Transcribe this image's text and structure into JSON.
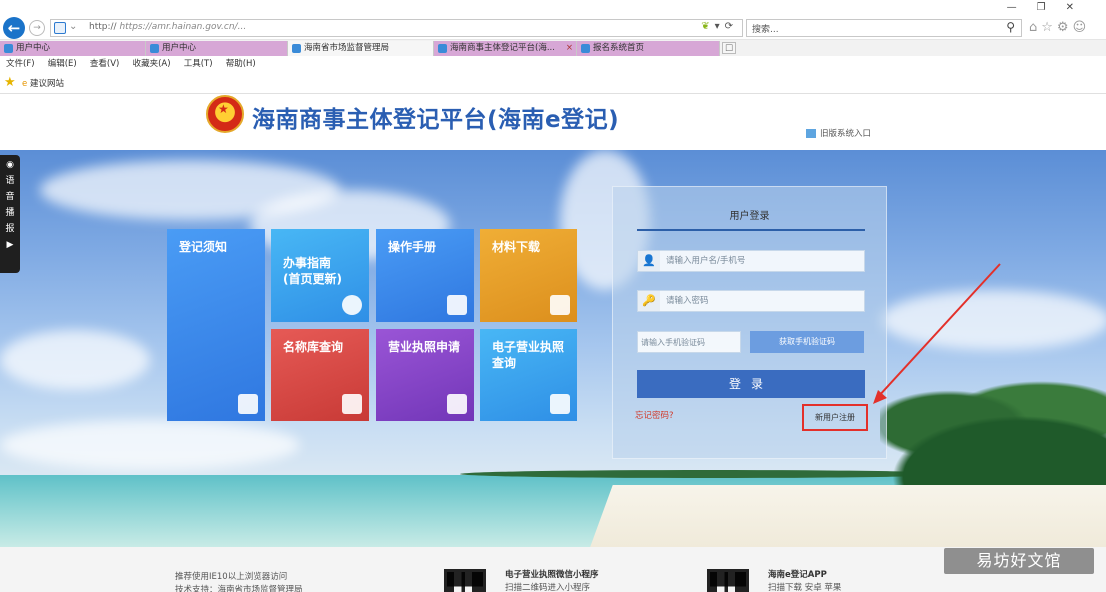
{
  "browser": {
    "url_prefix": "http://",
    "url": "https://amr.hainan.gov.cn/...",
    "url_right_icons": "⟳",
    "search_placeholder": "搜索...",
    "window_controls": [
      "—",
      "❐",
      "✕"
    ],
    "tabs": [
      {
        "label": "用户中心"
      },
      {
        "label": "用户中心"
      },
      {
        "label": "海南省市场监督管理局"
      },
      {
        "label": "海南商事主体登记平台(海..."
      },
      {
        "label": "报名系统首页"
      }
    ],
    "menu": [
      "文件(F)",
      "编辑(E)",
      "查看(V)",
      "收藏夹(A)",
      "工具(T)",
      "帮助(H)"
    ],
    "favorites": [
      {
        "label": "建议网站"
      }
    ]
  },
  "header": {
    "title": "海南商事主体登记平台(海南e登记)",
    "link": "旧版系统入口"
  },
  "side_toolbar": [
    "语",
    "音",
    "播",
    "报",
    "▶"
  ],
  "tiles": [
    {
      "label": "登记须知"
    },
    {
      "label": "办事指南\n(首页更新)"
    },
    {
      "label": "操作手册"
    },
    {
      "label": "材料下载"
    },
    {
      "label": "名称库查询"
    },
    {
      "label": "营业执照申请"
    },
    {
      "label": "电子营业执照查询"
    }
  ],
  "login": {
    "title": "用户登录",
    "username_placeholder": "请输入用户名/手机号",
    "password_placeholder": "请输入密码",
    "captcha_placeholder": "请输入手机验证码",
    "captcha_button": "获取手机验证码",
    "login_button": "登录",
    "forgot_link": "忘记密码?",
    "register_link": "新用户注册"
  },
  "footer": {
    "left_text_1": "推荐使用IE10以上浏览器访问",
    "left_text_2": "技术支持：海南省市场监督管理局",
    "mid_title": "电子营业执照微信小程序",
    "mid_sub": "扫描二维码进入小程序",
    "right_title": "海南e登记APP",
    "right_sub": "扫描下载 安卓 苹果"
  },
  "watermark": "易坊好文馆",
  "colors": {
    "title_blue": "#2a5eb2",
    "tile_blue": "#3d8ef0",
    "tile_orange": "#e6a12c",
    "tile_red": "#d64545",
    "tile_purple": "#8a45c9",
    "login_blue": "#3a6cc0",
    "annotation_red": "#e3302a"
  }
}
